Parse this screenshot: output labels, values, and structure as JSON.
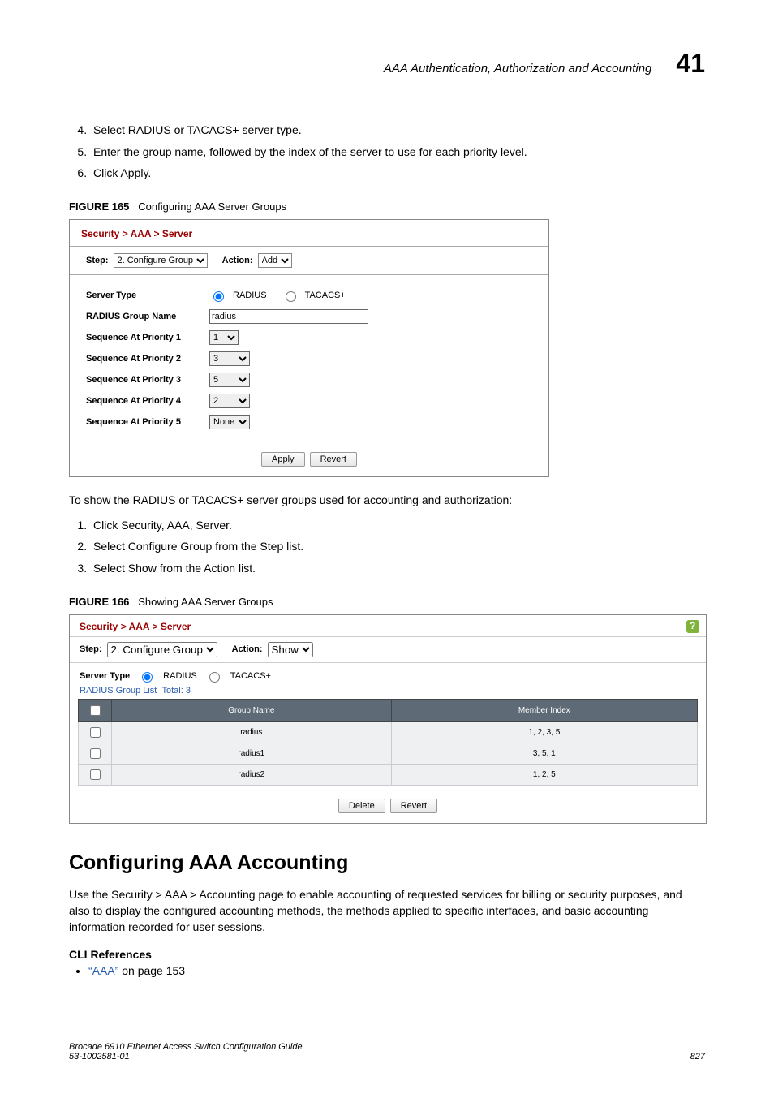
{
  "runningHead": {
    "title": "AAA Authentication, Authorization and Accounting",
    "chapnum": "41"
  },
  "stepsA": {
    "start": 4,
    "items": [
      "Select RADIUS or TACACS+ server type.",
      "Enter the group name, followed by the index of the server to use for each priority level.",
      "Click Apply."
    ]
  },
  "fig165": {
    "caption_label": "FIGURE 165",
    "caption_text": "Configuring AAA Server Groups",
    "crumb": "Security > AAA > Server",
    "step_label": "Step:",
    "step_value": "2. Configure Group",
    "action_label": "Action:",
    "action_value": "Add",
    "server_type_label": "Server Type",
    "server_type_opts": [
      "RADIUS",
      "TACACS+"
    ],
    "server_type_selected": "RADIUS",
    "group_name_label": "RADIUS Group Name",
    "group_name_value": "radius",
    "seq_labels": [
      "Sequence At Priority 1",
      "Sequence At Priority 2",
      "Sequence At Priority 3",
      "Sequence At Priority 4",
      "Sequence At Priority 5"
    ],
    "seq_values": [
      "1",
      "3",
      "5",
      "2",
      "None"
    ],
    "apply": "Apply",
    "revert": "Revert"
  },
  "midtext": "To show the RADIUS or TACACS+ server groups used for accounting and authorization:",
  "stepsB": {
    "start": 1,
    "items": [
      "Click Security, AAA, Server.",
      "Select Configure Group from the Step list.",
      "Select Show from the Action list."
    ]
  },
  "fig166": {
    "caption_label": "FIGURE 166",
    "caption_text": "Showing AAA Server Groups",
    "crumb": "Security > AAA > Server",
    "step_label": "Step:",
    "step_value": "2. Configure Group",
    "action_label": "Action:",
    "action_value": "Show",
    "server_type_label": "Server Type",
    "server_type_opts": [
      "RADIUS",
      "TACACS+"
    ],
    "server_type_selected": "RADIUS",
    "list_label": "RADIUS Group List",
    "total_label": "Total:",
    "total_value": "3",
    "columns": [
      "Group Name",
      "Member Index"
    ],
    "rows": [
      {
        "name": "radius",
        "members": "1, 2, 3, 5"
      },
      {
        "name": "radius1",
        "members": "3, 5, 1"
      },
      {
        "name": "radius2",
        "members": "1, 2, 5"
      }
    ],
    "delete": "Delete",
    "revert": "Revert"
  },
  "section": {
    "heading": "Configuring AAA Accounting",
    "para": "Use the Security > AAA > Accounting page to enable accounting of requested services for billing or security purposes, and also to display the configured accounting methods, the methods applied to specific interfaces, and basic accounting information recorded for user sessions.",
    "cli_head": "CLI References",
    "cli_link": "“AAA”",
    "cli_tail": " on page 153"
  },
  "footer": {
    "left1": "Brocade 6910 Ethernet Access Switch Configuration Guide",
    "left2": "53-1002581-01",
    "page": "827"
  }
}
